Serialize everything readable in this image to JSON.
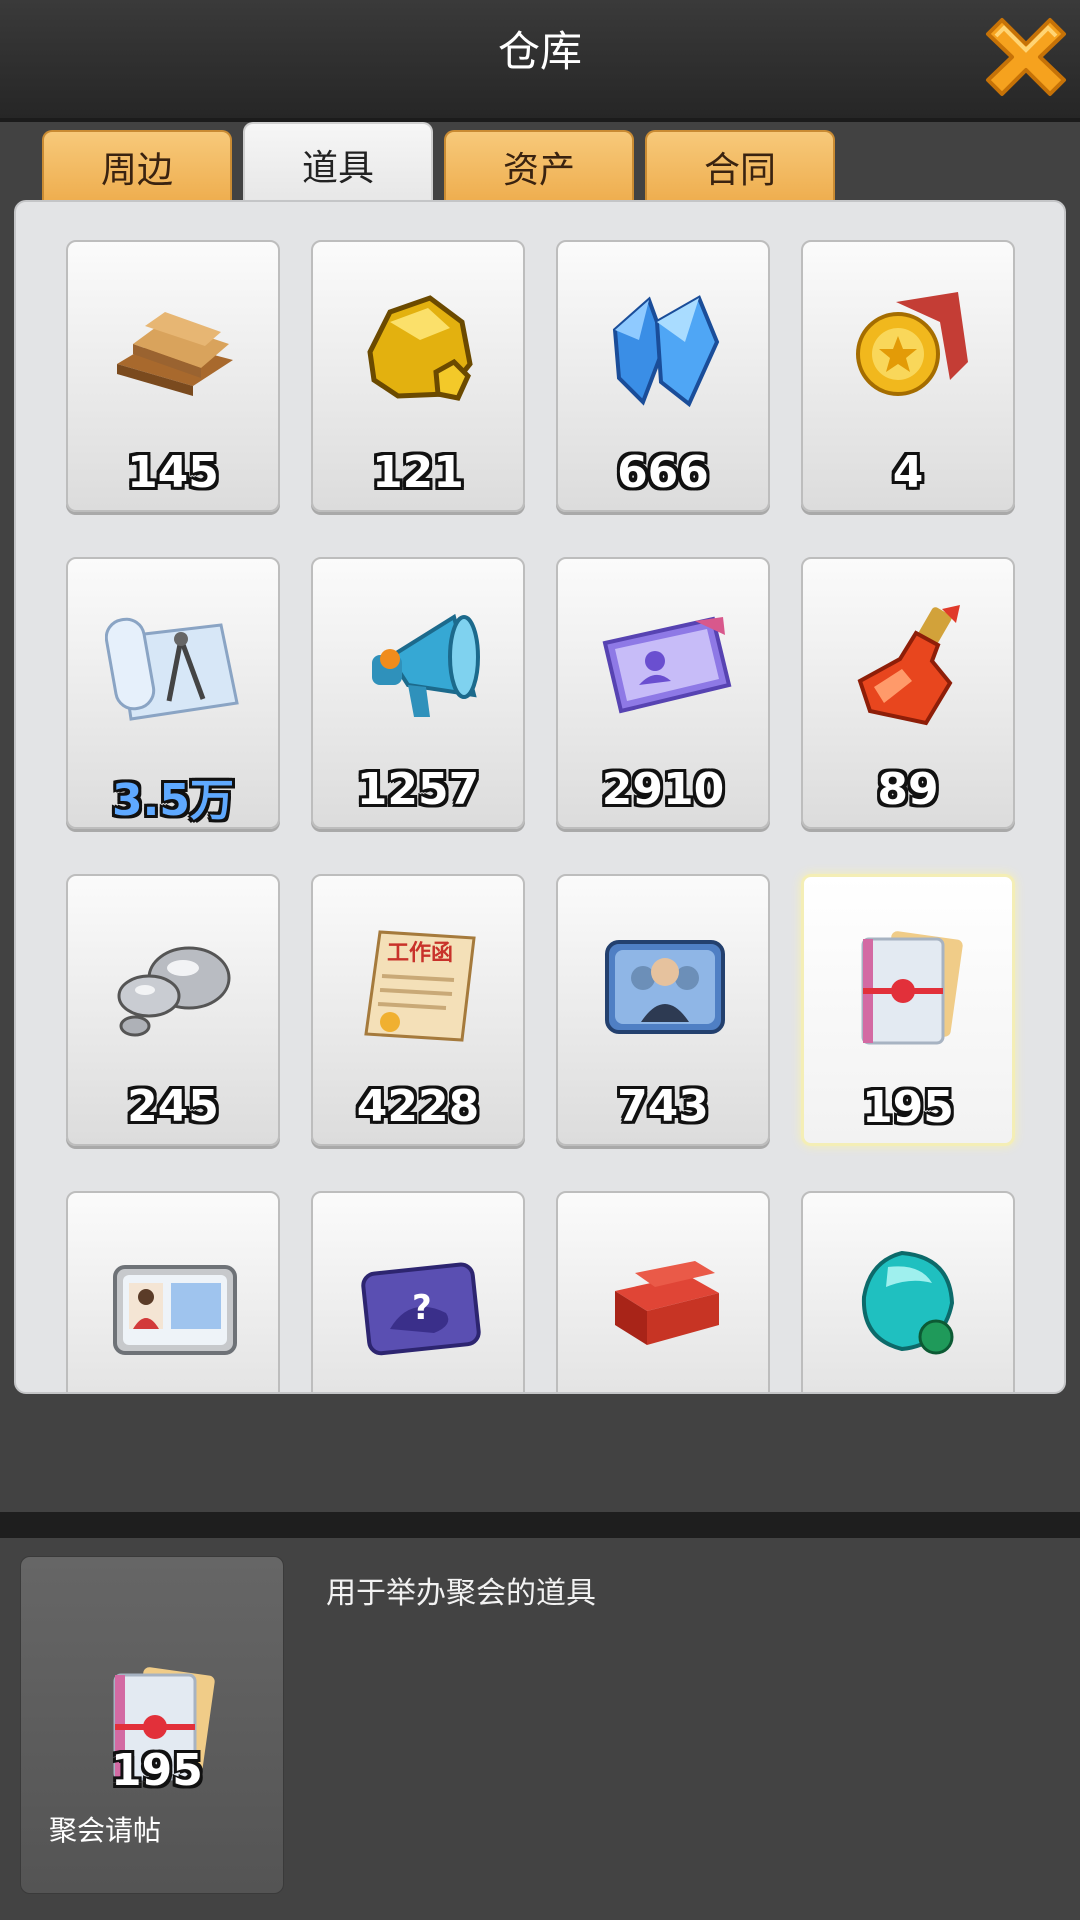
{
  "header": {
    "title": "仓库"
  },
  "tabs": [
    {
      "label": "周边",
      "active": false
    },
    {
      "label": "道具",
      "active": true
    },
    {
      "label": "资产",
      "active": false
    },
    {
      "label": "合同",
      "active": false
    }
  ],
  "items": [
    {
      "icon": "wood-planks-icon",
      "count": "145"
    },
    {
      "icon": "gold-ore-icon",
      "count": "121"
    },
    {
      "icon": "blue-crystal-icon",
      "count": "666"
    },
    {
      "icon": "gold-medal-scroll-icon",
      "count": "4"
    },
    {
      "icon": "blueprint-icon",
      "count": "3.5万"
    },
    {
      "icon": "megaphone-icon",
      "count": "1257"
    },
    {
      "icon": "purple-ticket-icon",
      "count": "2910"
    },
    {
      "icon": "potion-bottle-icon",
      "count": "89"
    },
    {
      "icon": "mercury-drops-icon",
      "count": "245"
    },
    {
      "icon": "work-letter-icon",
      "count": "4228",
      "text": "工作函"
    },
    {
      "icon": "headhunter-card-icon",
      "count": "743"
    },
    {
      "icon": "invitation-card-icon",
      "count": "195",
      "selected": true
    },
    {
      "icon": "id-card-icon"
    },
    {
      "icon": "mystery-card-icon"
    },
    {
      "icon": "red-bricks-icon"
    },
    {
      "icon": "teal-gem-icon"
    }
  ],
  "detail": {
    "icon": "invitation-card-icon",
    "count": "195",
    "name": "聚会请帖",
    "description": "用于举办聚会的道具"
  },
  "colors": {
    "tab_orange": "#eeac4c",
    "close_orange": "#f6a21e",
    "panel_bg": "#e3e4e6"
  }
}
